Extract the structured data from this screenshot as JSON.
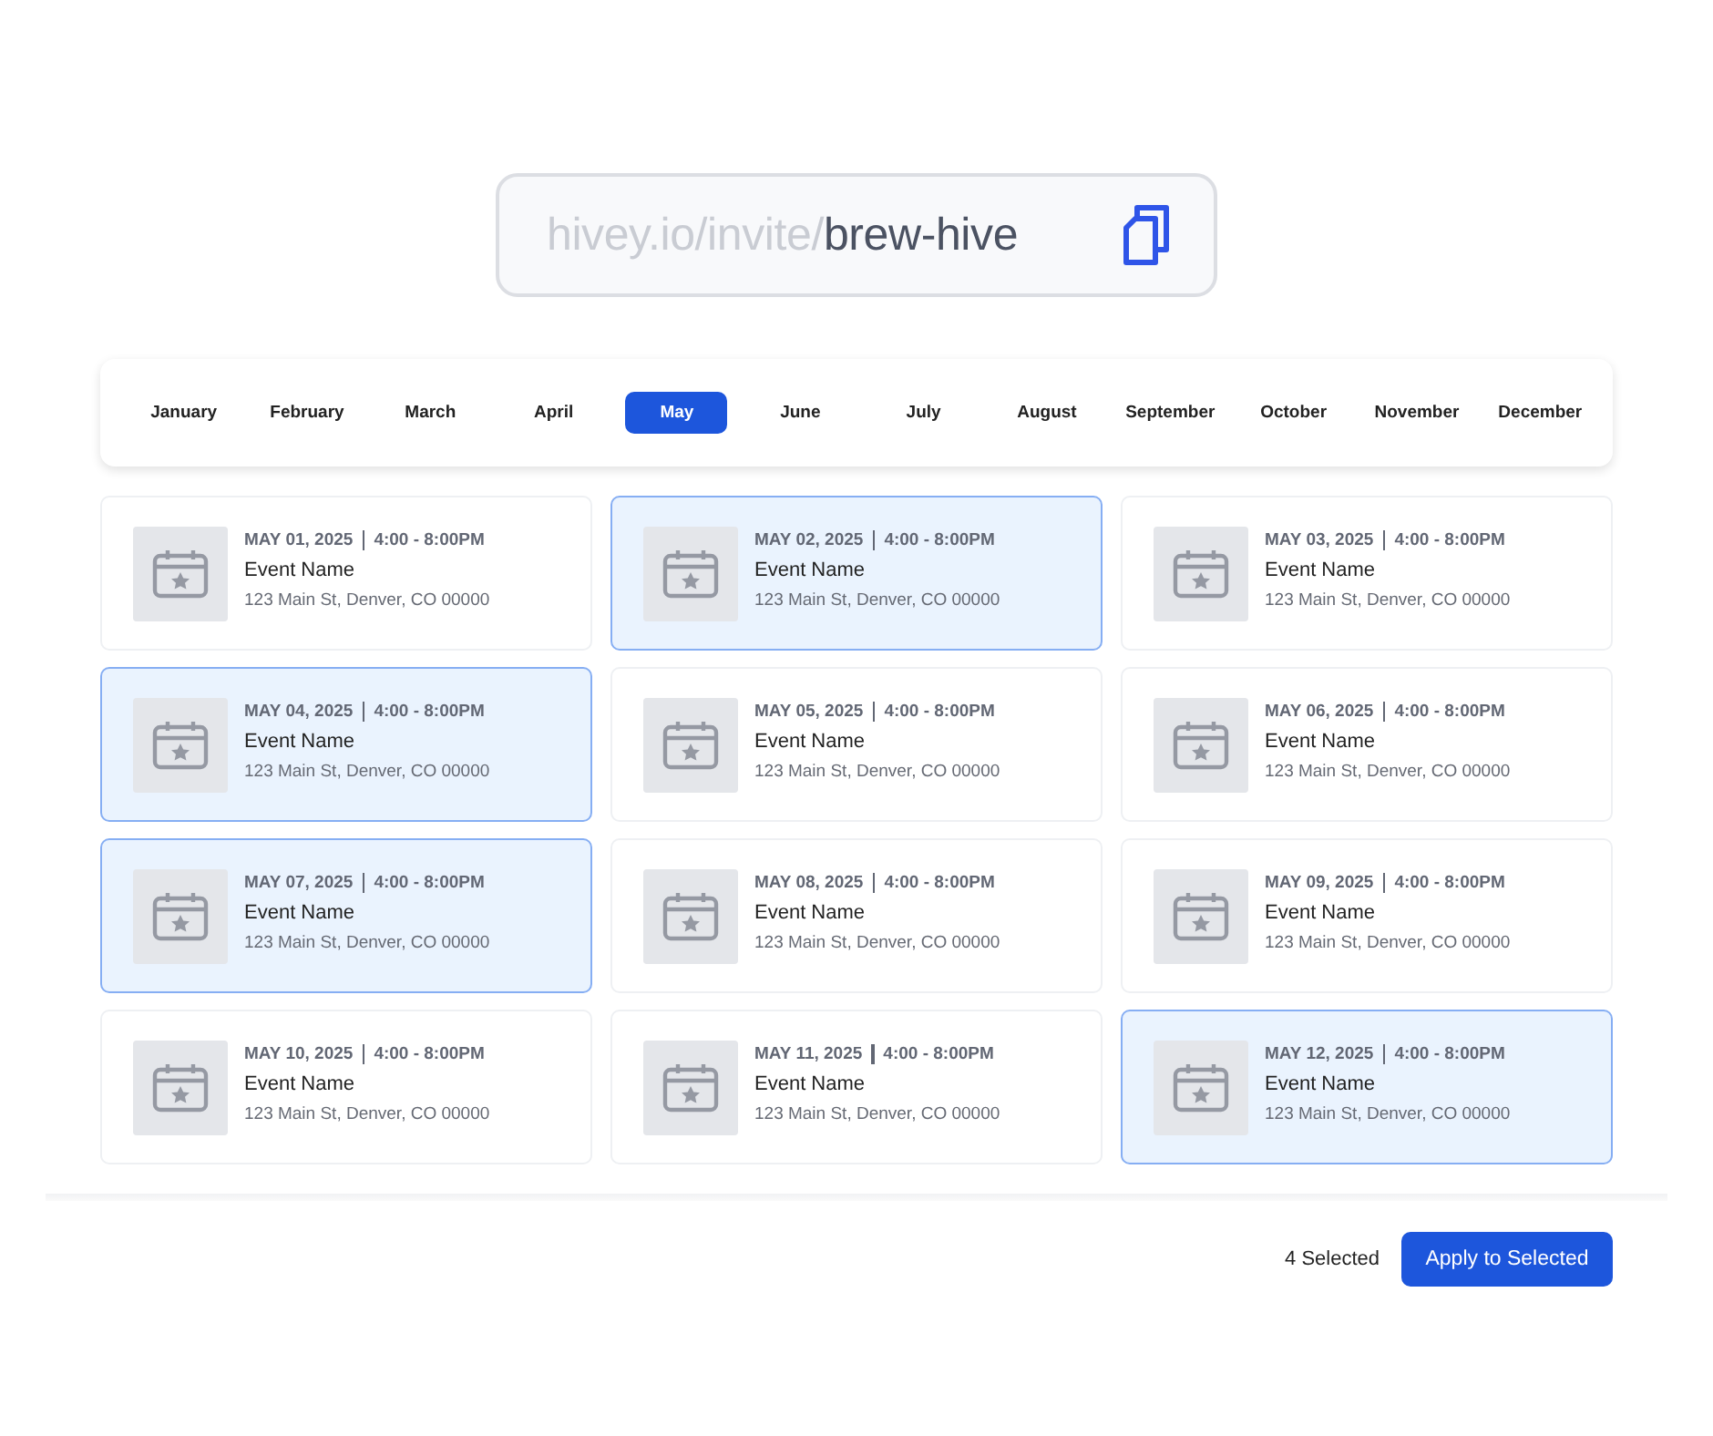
{
  "invite_link": {
    "prefix": "hivey.io/invite/",
    "slug": "brew-hive"
  },
  "months": [
    {
      "label": "January",
      "selected": false
    },
    {
      "label": "February",
      "selected": false
    },
    {
      "label": "March",
      "selected": false
    },
    {
      "label": "April",
      "selected": false
    },
    {
      "label": "May",
      "selected": true
    },
    {
      "label": "June",
      "selected": false
    },
    {
      "label": "July",
      "selected": false
    },
    {
      "label": "August",
      "selected": false
    },
    {
      "label": "September",
      "selected": false
    },
    {
      "label": "October",
      "selected": false
    },
    {
      "label": "November",
      "selected": false
    },
    {
      "label": "December",
      "selected": false
    }
  ],
  "events": [
    {
      "date": "MAY 01, 2025",
      "time": "4:00 - 8:00PM",
      "name": "Event Name",
      "address": "123 Main St, Denver, CO 00000",
      "selected": false
    },
    {
      "date": "MAY 02, 2025",
      "time": "4:00 - 8:00PM",
      "name": "Event Name",
      "address": "123 Main St, Denver, CO 00000",
      "selected": true
    },
    {
      "date": "MAY 03, 2025",
      "time": "4:00 - 8:00PM",
      "name": "Event Name",
      "address": "123 Main St, Denver, CO 00000",
      "selected": false
    },
    {
      "date": "MAY 04, 2025",
      "time": "4:00 - 8:00PM",
      "name": "Event Name",
      "address": "123 Main St, Denver, CO 00000",
      "selected": true
    },
    {
      "date": "MAY 05, 2025",
      "time": "4:00 - 8:00PM",
      "name": "Event Name",
      "address": "123 Main St, Denver, CO 00000",
      "selected": false
    },
    {
      "date": "MAY 06, 2025",
      "time": "4:00 - 8:00PM",
      "name": "Event Name",
      "address": "123 Main St, Denver, CO 00000",
      "selected": false
    },
    {
      "date": "MAY 07, 2025",
      "time": "4:00 - 8:00PM",
      "name": "Event Name",
      "address": "123 Main St, Denver, CO 00000",
      "selected": true
    },
    {
      "date": "MAY 08, 2025",
      "time": "4:00 - 8:00PM",
      "name": "Event Name",
      "address": "123 Main St, Denver, CO 00000",
      "selected": false
    },
    {
      "date": "MAY 09, 2025",
      "time": "4:00 - 8:00PM",
      "name": "Event Name",
      "address": "123 Main St, Denver, CO 00000",
      "selected": false
    },
    {
      "date": "MAY 10, 2025",
      "time": "4:00 - 8:00PM",
      "name": "Event Name",
      "address": "123 Main St, Denver, CO 00000",
      "selected": false
    },
    {
      "date": "MAY 11, 2025",
      "time": "4:00 - 8:00PM",
      "name": "Event Name",
      "address": "123 Main St, Denver, CO 00000",
      "selected": false
    },
    {
      "date": "MAY 12, 2025",
      "time": "4:00 - 8:00PM",
      "name": "Event Name",
      "address": "123 Main St, Denver, CO 00000",
      "selected": true
    }
  ],
  "footer": {
    "selected_count": "4 Selected",
    "apply_button": "Apply to Selected"
  }
}
